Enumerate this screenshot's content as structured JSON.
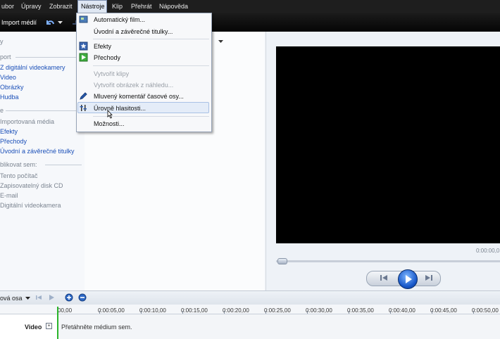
{
  "menubar": {
    "items": [
      "ubor",
      "Úpravy",
      "Zobrazit",
      "Nástroje",
      "Klip",
      "Přehrát",
      "Nápověda"
    ]
  },
  "toolbar": {
    "import_label": "Import médií"
  },
  "tasks": {
    "header1": "y",
    "header2": "port",
    "capture_items": [
      "Z digitální videokamery",
      "Video",
      "Obrázky",
      "Hudba"
    ],
    "header3": "e",
    "edit_items": [
      "Importovaná média",
      "Efekty",
      "Přechody",
      "Úvodní a závěrečné titulky"
    ],
    "header4": "blikovat sem:",
    "publish_items": [
      "Tento počítač",
      "Zapisovatelný disk CD",
      "E-mail",
      "Digitální videokamera"
    ]
  },
  "tools_menu": {
    "items": [
      {
        "label": "Automatický film...",
        "enabled": true
      },
      {
        "label": "Úvodní a závěrečné titulky...",
        "enabled": true
      },
      {
        "label": "Efekty",
        "enabled": true
      },
      {
        "label": "Přechody",
        "enabled": true
      },
      {
        "label": "Vytvořit klipy",
        "enabled": false
      },
      {
        "label": "Vytvořit obrázek z náhledu...",
        "enabled": false
      },
      {
        "label": "Mluvený komentář časové osy...",
        "enabled": true
      },
      {
        "label": "Úrovně hlasitosti...",
        "enabled": true,
        "highlighted": true
      },
      {
        "label": "Možnosti...",
        "enabled": true
      }
    ]
  },
  "preview": {
    "time": "0:00:00,0"
  },
  "timeline": {
    "mode_label": "ová osa",
    "ticks": [
      "00,00",
      "0:00:05,00",
      "0:00:10,00",
      "0:00:15,00",
      "0:00:20,00",
      "0:00:25,00",
      "0:00:30,00",
      "0:00:35,00",
      "0:00:40,00",
      "0:00:45,00",
      "0:00:50,00"
    ],
    "video_label": "Video",
    "drop_hint": "Přetáhněte médium sem."
  }
}
